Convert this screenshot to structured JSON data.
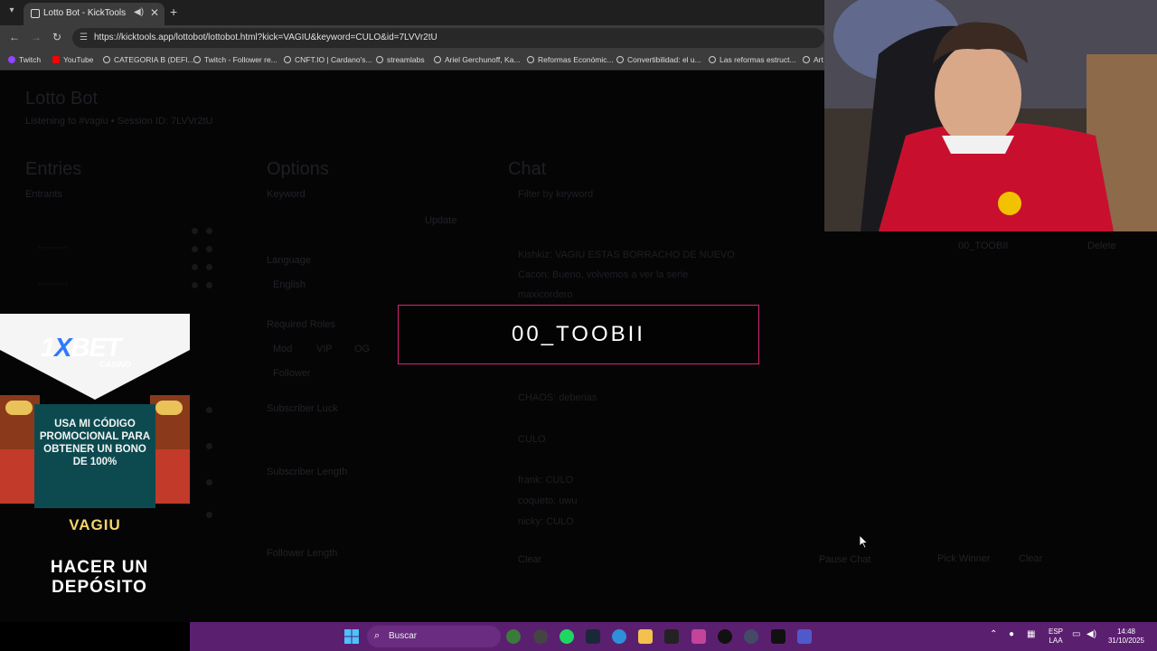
{
  "browser": {
    "tab_title": "Lotto Bot - KickTools",
    "url": "https://kicktools.app/lottobot/lottobot.html?kick=VAGIU&keyword=CULO&id=7LVVr2tU",
    "bookmarks": [
      "Twitch",
      "YouTube",
      "CATEGORIA B (DEFI...",
      "Twitch - Follower re...",
      "CNFT.IO | Cardano's...",
      "streamlabs",
      "Ariel Gerchunoff, Ka...",
      "Reformas Económic...",
      "Convertibilidad: el u...",
      "Las reformas estruct...",
      "Art"
    ]
  },
  "page": {
    "title": "Lotto Bot",
    "subtitle": "Listening to #vagiu • Session ID: 7LVVr2tU",
    "entries_heading": "Entries",
    "entries_label": "Entrants",
    "options_heading": "Options",
    "keyword_label": "Keyword",
    "update_button": "Update",
    "language_label": "Language",
    "language_value": "English",
    "required_roles_label": "Required Roles",
    "roles": [
      "Mod",
      "VIP",
      "OG",
      "Follower"
    ],
    "subscriber_luck_label": "Subscriber Luck",
    "subscriber_length_label": "Subscriber Length",
    "follower_length_label": "Follower Length",
    "chat_heading": "Chat",
    "chat_lines": [
      "Filter by keyword",
      "Kishkiz: VAGIU ESTAS BORRACHO DE NUEVO",
      "Cacon: Bueno, volvemos a ver la serie",
      "maxicordero",
      "CHAOS: deberias",
      "CULO",
      "frank: CULO",
      "coqueto: uwu",
      "nicky: CULO"
    ],
    "clear_button": "Clear",
    "pick_winner_button": "Pick Winner",
    "pause_button": "Pause Chat",
    "winner_label": "00_TOOBII",
    "winner_side_label": "Delete"
  },
  "winner": {
    "name": "00_TOOBII"
  },
  "ad": {
    "brand_prefix": "1",
    "brand_x": "X",
    "brand_suffix": "BET",
    "casino": "CASINO",
    "promo": "USA MI CÓDIGO PROMOCIONAL PARA OBTENER UN BONO DE 100%",
    "code": "VAGIU",
    "cta": "HACER UN DEPÓSITO"
  },
  "taskbar": {
    "search_placeholder": "Buscar",
    "lang_top": "ESP",
    "lang_bottom": "LAA",
    "time": "14:48",
    "date": "31/10/2025"
  }
}
